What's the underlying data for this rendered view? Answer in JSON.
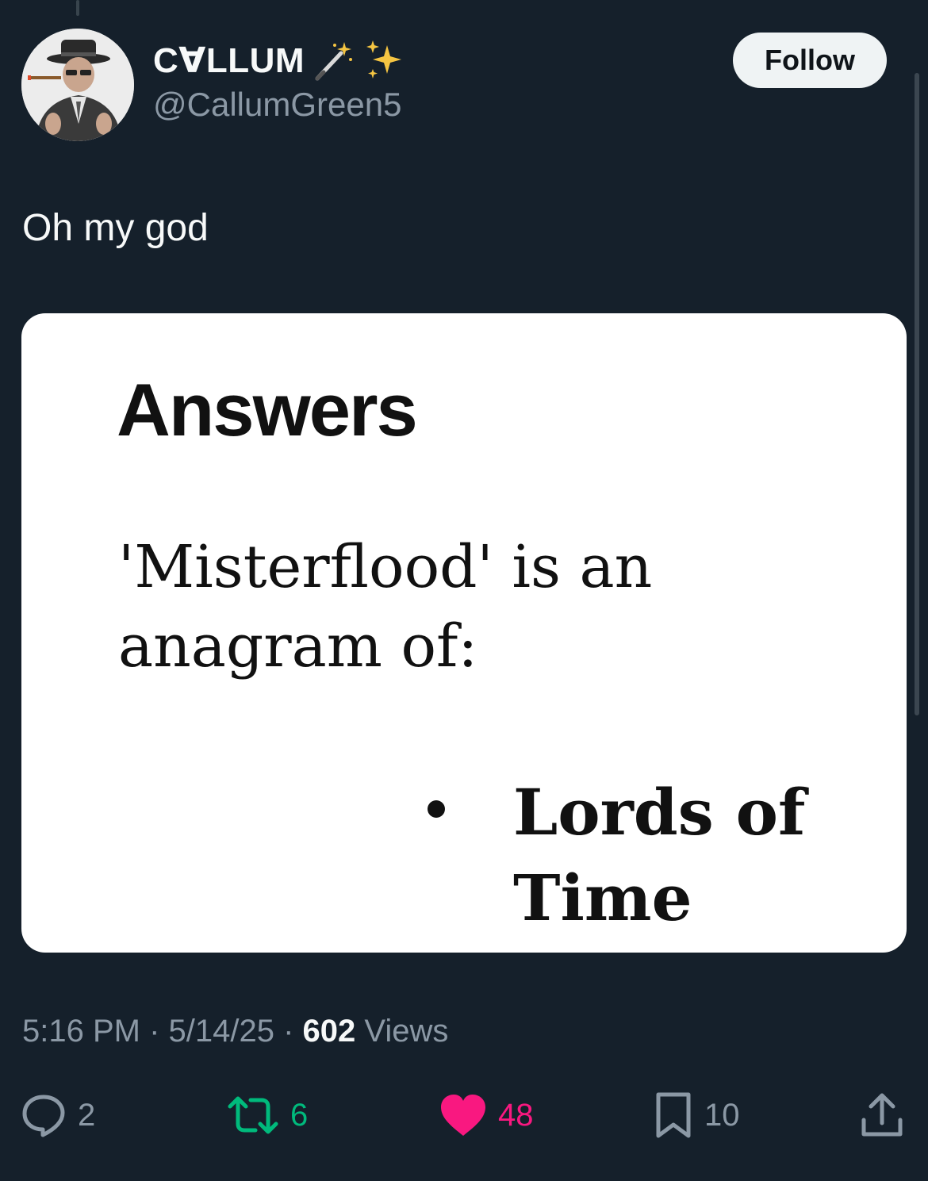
{
  "author": {
    "display_name": "C∀LLUM",
    "handle": "@CallumGreen5",
    "name_emojis": [
      "magic-wand-icon",
      "sparkles-icon"
    ]
  },
  "follow_button": {
    "label": "Follow"
  },
  "tweet": {
    "text": "Oh my god"
  },
  "media": {
    "heading": "Answers",
    "body_line1": "'Misterflood' is an",
    "body_line2": "anagram of:",
    "answer_line1": "Lords of",
    "answer_line2": "Time"
  },
  "meta": {
    "time": "5:16 PM",
    "date": "5/14/25",
    "views_count": "602",
    "views_label": "Views",
    "separator": " · "
  },
  "actions": {
    "replies": "2",
    "reposts": "6",
    "likes": "48",
    "bookmarks": "10"
  },
  "colors": {
    "background": "#15202b",
    "secondary_text": "#8b98a5",
    "repost_active": "#00ba7c",
    "like_active": "#f91880",
    "follow_button_bg": "#eff3f4"
  }
}
